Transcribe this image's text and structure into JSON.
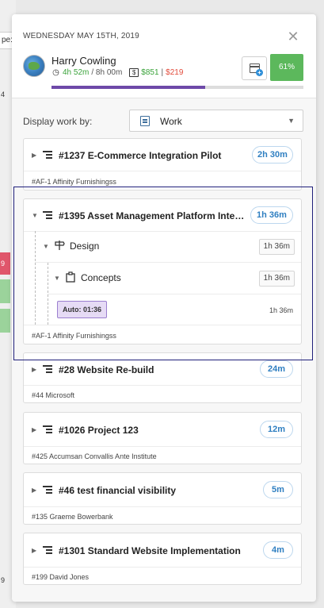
{
  "background": {
    "partial_text": "pe:",
    "num_a": "4",
    "num_b": "9",
    "num_c": "9"
  },
  "header": {
    "date": "WEDNESDAY MAY 15TH, 2019",
    "user_name": "Harry Cowling",
    "time_logged": "4h 52m",
    "time_target": "/ 8h 00m",
    "money_earned": "$851",
    "money_separator": "|",
    "money_other": "$219",
    "percent": "61%",
    "progress_fraction": 0.61,
    "colors": {
      "accent_green": "#5cb85c",
      "progress": "#6e49a8",
      "money_red": "#e24b3b"
    }
  },
  "display": {
    "label": "Display work by:",
    "selected": "Work"
  },
  "projects": [
    {
      "title": "#1237 E-Commerce Integration Pilot",
      "time": "2h 30m",
      "client": "#AF-1 Affinity Furnishingss"
    },
    {
      "title": "#1395 Asset Management Platform Integra...",
      "time": "1h 36m",
      "client": "#AF-1 Affinity Furnishingss",
      "children": {
        "phase": {
          "label": "Design",
          "time": "1h 36m"
        },
        "task": {
          "label": "Concepts",
          "time": "1h 36m"
        },
        "entry": {
          "label": "Auto:",
          "timer": "01:36",
          "time": "1h 36m"
        }
      }
    },
    {
      "title": "#28 Website Re-build",
      "time": "24m",
      "client": "#44 Microsoft"
    },
    {
      "title": "#1026 Project 123",
      "time": "12m",
      "client": "#425 Accumsan Convallis Ante Institute"
    },
    {
      "title": "#46 test financial visibility",
      "time": "5m",
      "client": "#135 Graeme Bowerbank"
    },
    {
      "title": "#1301 Standard Website Implementation",
      "time": "4m",
      "client": "#199 David Jones"
    }
  ]
}
